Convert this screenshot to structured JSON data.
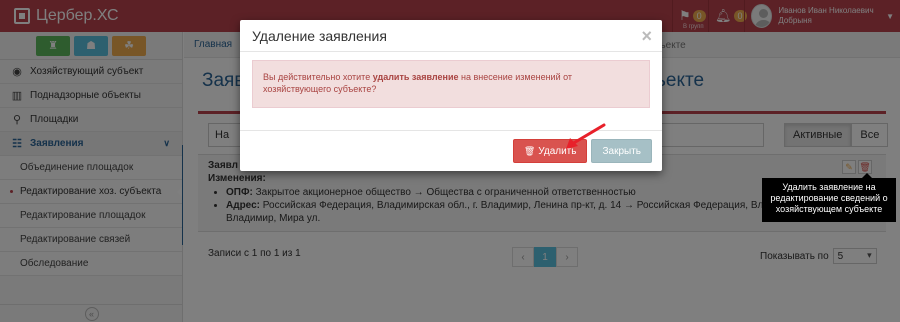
{
  "app": {
    "brand": "Цербер.ХС"
  },
  "topbar": {
    "groups_count": "0",
    "groups_label": "В групп",
    "notif_count": "0",
    "user_name": "Иванов Иван Николаевич Добрыня"
  },
  "sidebar": {
    "items": [
      {
        "label": "Хозяйствующий субъект"
      },
      {
        "label": "Поднадзорные объекты"
      },
      {
        "label": "Площадки"
      },
      {
        "label": "Заявления"
      }
    ],
    "subitems": [
      {
        "label": "Объединение площадок"
      },
      {
        "label": "Редактирование хоз. субъекта"
      },
      {
        "label": "Редактирование площадок"
      },
      {
        "label": "Редактирование связей"
      },
      {
        "label": "Обследование"
      }
    ]
  },
  "breadcrumb": {
    "home": "Главная",
    "tail": "бъекте"
  },
  "page": {
    "title": "Заяв",
    "title_tail": "ъекте"
  },
  "search": {
    "value": "На"
  },
  "filters": {
    "active": "Активные",
    "all": "Все"
  },
  "record": {
    "title": "Заявл",
    "changes_label": "Изменения:",
    "change1_key": "ОПФ:",
    "change1_val": "Закрытое акционерное общество → Общества с ограниченной ответственностью",
    "change2_key": "Адрес:",
    "change2_val": "Российская Федерация, Владимирская обл., г. Владимир, Ленина пр-кт, д. 14 → Российская Федерация, Владимирская обл., г. Владимир, Мира ул."
  },
  "footer": {
    "records_info": "Записи с 1 по 1 из 1",
    "page_current": "1",
    "show_by_label": "Показывать по",
    "show_by_value": "5"
  },
  "modal": {
    "title": "Удаление заявления",
    "alert_prefix": "Вы действительно хотите ",
    "alert_bold": "удалить заявление",
    "alert_suffix": " на внесение изменений от хозяйствующего субъекте?",
    "delete_label": "Удалить",
    "close_label": "Закрыть"
  },
  "tooltip": {
    "text": "Удалить заявление на редактирование сведений о хозяйствующем субъекте"
  },
  "colors": {
    "brand": "#b9424d",
    "danger": "#d9534f",
    "link": "#2a6496"
  }
}
